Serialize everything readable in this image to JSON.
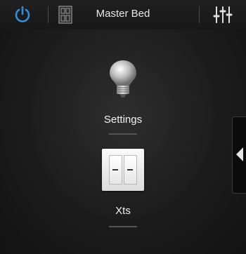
{
  "header": {
    "room_title": "Master Bed",
    "power_icon": "power-icon",
    "door_icon": "door-icon",
    "settings_sliders_icon": "sliders-icon"
  },
  "devices": [
    {
      "label": "Settings",
      "icon": "light-bulb-icon"
    },
    {
      "label": "Xts",
      "icon": "light-switch-icon"
    }
  ],
  "side_panel": {
    "icon": "chevron-left-icon"
  },
  "colors": {
    "accent": "#2f8fdc",
    "background": "#1c1c1c",
    "text": "#ffffff"
  }
}
